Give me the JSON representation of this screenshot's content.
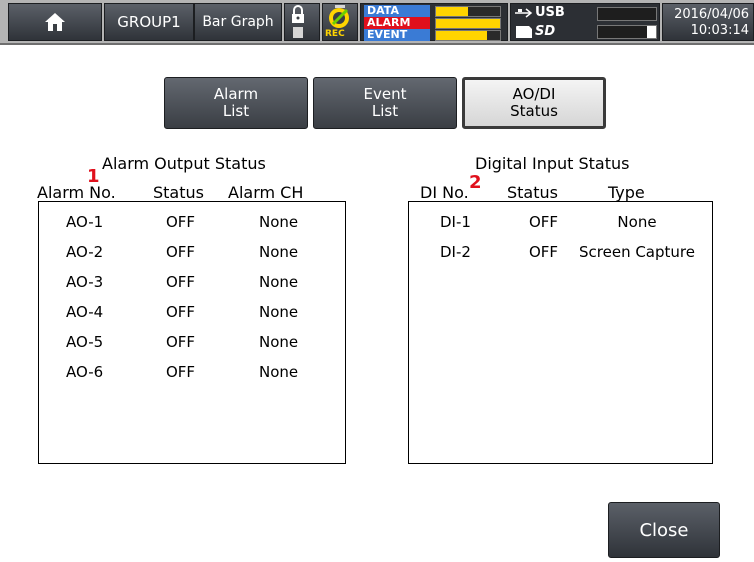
{
  "header": {
    "group_label": "GROUP1",
    "view_label": "Bar Graph",
    "rec_label": "REC",
    "status_rows": [
      {
        "label": "DATA",
        "color": "#3a7bd5"
      },
      {
        "label": "ALARM",
        "color": "#e0101c"
      },
      {
        "label": "EVENT",
        "color": "#3a7bd5"
      }
    ],
    "usb_label": "USB",
    "sd_label": "SD",
    "date": "2016/04/06",
    "time": "10:03:14"
  },
  "tabs": [
    {
      "line1": "Alarm",
      "line2": "List",
      "active": false
    },
    {
      "line1": "Event",
      "line2": "List",
      "active": false
    },
    {
      "line1": "AO/DI",
      "line2": "Status",
      "active": true
    }
  ],
  "alarm_output": {
    "title": "Alarm Output Status",
    "headers": [
      "Alarm No.",
      "Status",
      "Alarm CH"
    ],
    "marker": "1",
    "rows": [
      [
        "AO-1",
        "OFF",
        "None"
      ],
      [
        "AO-2",
        "OFF",
        "None"
      ],
      [
        "AO-3",
        "OFF",
        "None"
      ],
      [
        "AO-4",
        "OFF",
        "None"
      ],
      [
        "AO-5",
        "OFF",
        "None"
      ],
      [
        "AO-6",
        "OFF",
        "None"
      ]
    ]
  },
  "digital_input": {
    "title": "Digital Input Status",
    "headers": [
      "DI No.",
      "Status",
      "Type"
    ],
    "marker": "2",
    "rows": [
      [
        "DI-1",
        "OFF",
        "None"
      ],
      [
        "DI-2",
        "OFF",
        "Screen Capture"
      ]
    ]
  },
  "close_label": "Close",
  "colors": {
    "accent_red": "#e0101c",
    "meter_yellow": "#ffd400"
  }
}
